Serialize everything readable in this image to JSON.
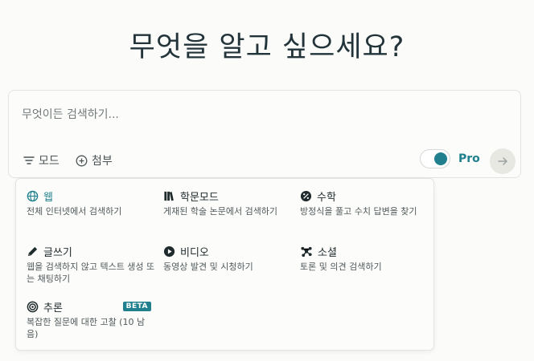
{
  "title": "무엇을 알고 싶으세요?",
  "search": {
    "placeholder": "무엇이든 검색하기..."
  },
  "toolbar": {
    "mode_label": "모드",
    "attach_label": "첨부",
    "pro_label": "Pro",
    "pro_enabled": true
  },
  "colors": {
    "accent": "#20808d",
    "background": "#fbfbf9"
  },
  "modes": [
    {
      "name": "웹",
      "desc": "전체 인터넷에서 검색하기",
      "icon": "globe-icon",
      "active": true
    },
    {
      "name": "학문모드",
      "desc": "게재된 학술 논문에서 검색하기",
      "icon": "books-icon"
    },
    {
      "name": "수학",
      "desc": "방정식을 풀고 수치 답변을 찾기",
      "icon": "percent-icon"
    },
    {
      "name": "글쓰기",
      "desc": "웹을 검색하지 않고 텍스트 생성 또는 채팅하기",
      "icon": "pencil-icon"
    },
    {
      "name": "비디오",
      "desc": "동영상 발견 및 시청하기",
      "icon": "play-icon"
    },
    {
      "name": "소셜",
      "desc": "토론 및 의견 검색하기",
      "icon": "network-icon"
    },
    {
      "name": "추론",
      "desc": "복잡한 질문에 대한 고찰 (10 남음)",
      "icon": "target-icon",
      "badge": "BETA"
    }
  ]
}
